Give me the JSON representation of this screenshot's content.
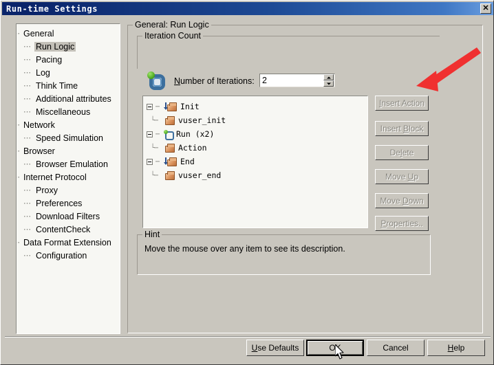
{
  "window": {
    "title": "Run-time Settings",
    "close_label": "✕"
  },
  "sidebar": {
    "items": [
      {
        "label": "General",
        "level": 0,
        "selected": false
      },
      {
        "label": "Run Logic",
        "level": 1,
        "selected": true
      },
      {
        "label": "Pacing",
        "level": 1,
        "selected": false
      },
      {
        "label": "Log",
        "level": 1,
        "selected": false
      },
      {
        "label": "Think Time",
        "level": 1,
        "selected": false
      },
      {
        "label": "Additional attributes",
        "level": 1,
        "selected": false
      },
      {
        "label": "Miscellaneous",
        "level": 1,
        "selected": false
      },
      {
        "label": "Network",
        "level": 0,
        "selected": false
      },
      {
        "label": "Speed Simulation",
        "level": 1,
        "selected": false
      },
      {
        "label": "Browser",
        "level": 0,
        "selected": false
      },
      {
        "label": "Browser Emulation",
        "level": 1,
        "selected": false
      },
      {
        "label": "Internet Protocol",
        "level": 0,
        "selected": false
      },
      {
        "label": "Proxy",
        "level": 1,
        "selected": false
      },
      {
        "label": "Preferences",
        "level": 1,
        "selected": false
      },
      {
        "label": "Download Filters",
        "level": 1,
        "selected": false
      },
      {
        "label": "ContentCheck",
        "level": 1,
        "selected": false
      },
      {
        "label": "Data Format Extension",
        "level": 0,
        "selected": false
      },
      {
        "label": "Configuration",
        "level": 1,
        "selected": false
      }
    ]
  },
  "main": {
    "group_title": "General: Run Logic",
    "iteration": {
      "group_title": "Iteration Count",
      "field_label": "Number of Iterations:",
      "field_accesskey": "N",
      "value": "2"
    },
    "action_tree": [
      {
        "label": "Init",
        "level": 0,
        "icon": "init-block-icon",
        "expander": true
      },
      {
        "label": "vuser_init",
        "level": 1,
        "icon": "brick-icon",
        "expander": false
      },
      {
        "label": "Run  (x2)",
        "level": 0,
        "icon": "loop-icon",
        "expander": true
      },
      {
        "label": "Action",
        "level": 1,
        "icon": "brick-icon",
        "expander": false
      },
      {
        "label": "End",
        "level": 0,
        "icon": "end-block-icon",
        "expander": true
      },
      {
        "label": "vuser_end",
        "level": 1,
        "icon": "brick-icon",
        "expander": false
      }
    ],
    "side_buttons": [
      {
        "label": "Insert Action",
        "accesskey": "I",
        "enabled": false
      },
      {
        "label": "Insert Block",
        "accesskey": "B",
        "enabled": false
      },
      {
        "label": "Delete",
        "accesskey": "l",
        "enabled": false
      },
      {
        "label": "Move Up",
        "accesskey": "U",
        "enabled": false
      },
      {
        "label": "Move Down",
        "accesskey": "D",
        "enabled": false
      },
      {
        "label": "Properties..",
        "accesskey": "P",
        "enabled": false
      }
    ],
    "hint": {
      "group_title": "Hint",
      "text": "Move the mouse over any item to see its description."
    }
  },
  "footer": {
    "buttons": [
      {
        "label": "Use Defaults",
        "accesskey": "U",
        "default": false
      },
      {
        "label": "OK",
        "accesskey": "",
        "default": true
      },
      {
        "label": "Cancel",
        "accesskey": "",
        "default": false
      },
      {
        "label": "Help",
        "accesskey": "H",
        "default": false
      }
    ]
  },
  "annotation": {
    "arrow_color": "#f03030",
    "points_to": "Number of Iterations spinner"
  },
  "colors": {
    "window_background": "#c9c6be",
    "titlebar_start": "#0a246a",
    "titlebar_end": "#6a9ee0",
    "field_background": "#ffffff",
    "panel_background": "#f7f7f3",
    "selection": "#c3c0b8",
    "disabled_text": "#8a8880"
  }
}
